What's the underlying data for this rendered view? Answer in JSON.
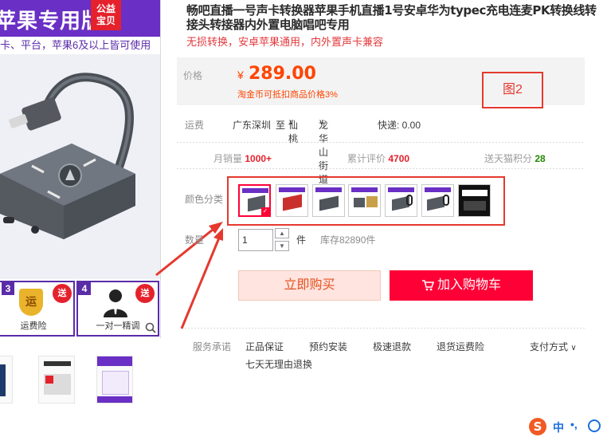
{
  "hero": {
    "title": "苹果专用版",
    "badge_line1": "公益",
    "badge_line2": "宝贝",
    "subtitle": "卡、平台，苹果6及以上皆可使用",
    "tile3_num": "3",
    "tile3_icon_text": "运",
    "tile3_send": "送",
    "tile3_label": "运费险",
    "tile4_num": "4",
    "tile4_send": "送",
    "tile4_label": "一对一精调"
  },
  "product": {
    "title": "畅吧直播一号声卡转换器苹果手机直播1号安卓华为typec充电连麦PK转换线转接头转接器内外置电脑唱吧专用",
    "subtitle": "无损转换，安卓苹果通用，内外置声卡兼容"
  },
  "price": {
    "label": "价格",
    "currency": "¥",
    "value": "289.00",
    "note": "淘金币可抵扣商品价格3%"
  },
  "annotation": {
    "figure_label": "图2"
  },
  "shipping": {
    "label": "运费",
    "from": "广东深圳",
    "to_word": "至",
    "city": "仙桃",
    "district": "龙华山街道",
    "express": "快递: 0.00"
  },
  "stats": {
    "monthly_sales_label": "月销量",
    "monthly_sales_value": "1000+",
    "reviews_label": "累计评价",
    "reviews_value": "4700",
    "points_label": "送天猫积分",
    "points_value": "28"
  },
  "sku": {
    "color_label": "颜色分类",
    "swatch_count": 7,
    "selected_index": 0
  },
  "quantity": {
    "label": "数量",
    "value": "1",
    "unit": "件",
    "stock": "库存82890件"
  },
  "actions": {
    "buy_now": "立即购买",
    "add_to_cart": "加入购物车"
  },
  "services": {
    "label": "服务承诺",
    "items": [
      "正品保证",
      "预约安装",
      "极速退款",
      "退货运费险",
      "七天无理由退换"
    ],
    "payment": "支付方式"
  },
  "ime": {
    "logo": "S",
    "mode": "中",
    "punct": "•,"
  },
  "colors": {
    "accent": "#ff0036",
    "price": "#ff4400",
    "annotation": "#e5392e",
    "banner": "#6a2fc4"
  }
}
